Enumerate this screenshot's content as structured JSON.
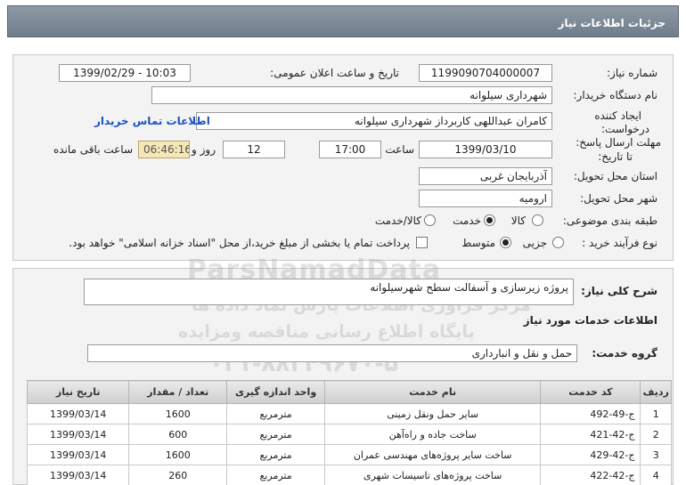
{
  "header": {
    "title": "جزئیات اطلاعات نیاز"
  },
  "form": {
    "need_number_label": "شماره نیاز:",
    "need_number": "1199090704000007",
    "announce_label": "تاریخ و ساعت اعلان عمومی:",
    "announce_value": "1399/02/29 - 10:03",
    "buyer_org_label": "نام دستگاه خریدار:",
    "buyer_org": "شهرداری سیلوانه",
    "creator_label_1": "ایجاد کننده",
    "creator_label_2": "درخواست:",
    "creator": "کامران عبداللهی کاربرداز شهرداری سیلوانه",
    "contact_link": "اطلاعات تماس خریدار",
    "deadline_label_1": "مهلت ارسال پاسخ:",
    "deadline_label_2": "تا تاریخ:",
    "deadline_date": "1399/03/10",
    "time_label": "ساعت",
    "deadline_time": "17:00",
    "days_value": "12",
    "days_label": "روز و",
    "remaining_time": "06:46:16",
    "remaining_label": "ساعت باقی مانده",
    "province_label": "استان محل تحویل:",
    "province": "آذربایجان غربی",
    "city_label": "شهر محل تحویل:",
    "city": "ارومیه",
    "category_label": "طبقه بندی موضوعی:",
    "category_options": [
      "کالا",
      "خدمت",
      "کالا/خدمت"
    ],
    "category_selected": "خدمت",
    "process_label": "نوع فرآیند خرید :",
    "process_options": [
      "جزیی",
      "متوسط"
    ],
    "process_selected": "متوسط",
    "payment_note": "پرداخت تمام یا بخشی از مبلغ خرید،از محل \"اسناد خزانه اسلامی\" خواهد بود."
  },
  "description": {
    "label": "شرح کلی نیاز:",
    "value": "پروژه زیرسازی و آسفالت سطح شهرسیلوانه"
  },
  "services": {
    "section_title": "اطلاعات خدمات مورد نیاز",
    "group_label": "گروه خدمت:",
    "group_value": "حمل و نقل و انبارداری",
    "columns": [
      "ردیف",
      "کد خدمت",
      "نام خدمت",
      "واحد اندازه گیری",
      "تعداد / مقدار",
      "تاریخ نیاز"
    ],
    "rows": [
      {
        "row": "1",
        "code": "ج-49-492",
        "name": "سایر حمل ونقل زمینی",
        "unit": "مترمربع",
        "qty": "1600",
        "date": "1399/03/14"
      },
      {
        "row": "2",
        "code": "ج-42-421",
        "name": "ساخت جاده و راه‌آهن",
        "unit": "مترمربع",
        "qty": "600",
        "date": "1399/03/14"
      },
      {
        "row": "3",
        "code": "ج-42-429",
        "name": "ساخت سایر پروژه‌های مهندسی عمران",
        "unit": "مترمربع",
        "qty": "1600",
        "date": "1399/03/14"
      },
      {
        "row": "4",
        "code": "ج-42-422",
        "name": "ساخت پروژه‌های تاسیسات شهری",
        "unit": "مترمربع",
        "qty": "260",
        "date": "1399/03/14"
      }
    ]
  },
  "watermark": {
    "line1": "ParsNamadData",
    "line2": "مرکز فراوری اطلاعات پارس نماد داده ها",
    "line3": "پایگاه اطلاع رسانی مناقصه ومزایده",
    "line4": "۰۲۱-۸۸۳۴۹۶۷۰-۵"
  }
}
